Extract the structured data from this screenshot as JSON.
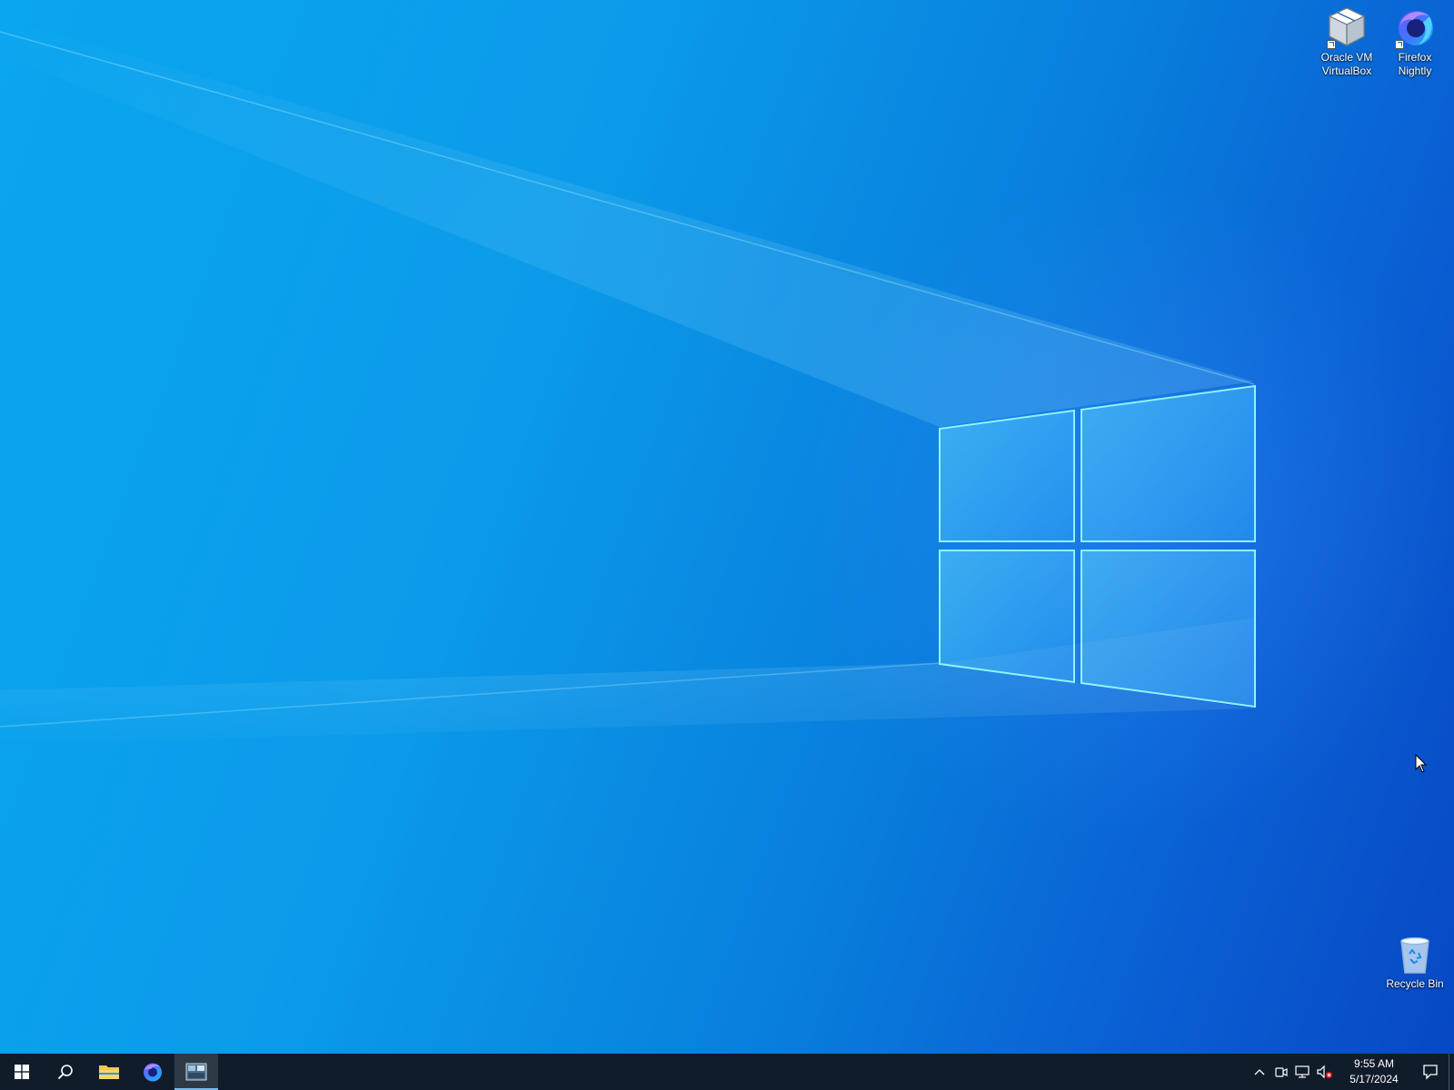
{
  "desktop": {
    "icons": [
      {
        "name": "virtualbox",
        "label": "Oracle VM\nVirtualBox",
        "icon": "virtualbox-icon",
        "shortcut": true
      },
      {
        "name": "firefox-nightly",
        "label": "Firefox\nNightly",
        "icon": "firefox-nightly-icon",
        "shortcut": true
      },
      {
        "name": "recycle-bin",
        "label": "Recycle Bin",
        "icon": "recycle-bin-icon",
        "shortcut": false
      }
    ]
  },
  "taskbar": {
    "buttons": [
      {
        "name": "start",
        "icon": "windows-logo-icon"
      },
      {
        "name": "search",
        "icon": "search-icon"
      },
      {
        "name": "file-explorer",
        "icon": "folder-icon"
      },
      {
        "name": "firefox-nightly",
        "icon": "firefox-nightly-icon"
      },
      {
        "name": "app-window",
        "icon": "app-thumbnail-icon",
        "active": true
      }
    ],
    "tray": {
      "icons": [
        "chevron-up-icon",
        "meet-now-icon",
        "network-icon",
        "volume-muted-icon"
      ],
      "time": "9:55 AM",
      "date": "5/17/2024",
      "notification_icon": "action-center-icon"
    }
  },
  "colors": {
    "desktop_light": "#0aa6ef",
    "desktop_dark": "#0748c4",
    "taskbar": "#111c2b",
    "logo_glass": "#4fc8ff"
  }
}
